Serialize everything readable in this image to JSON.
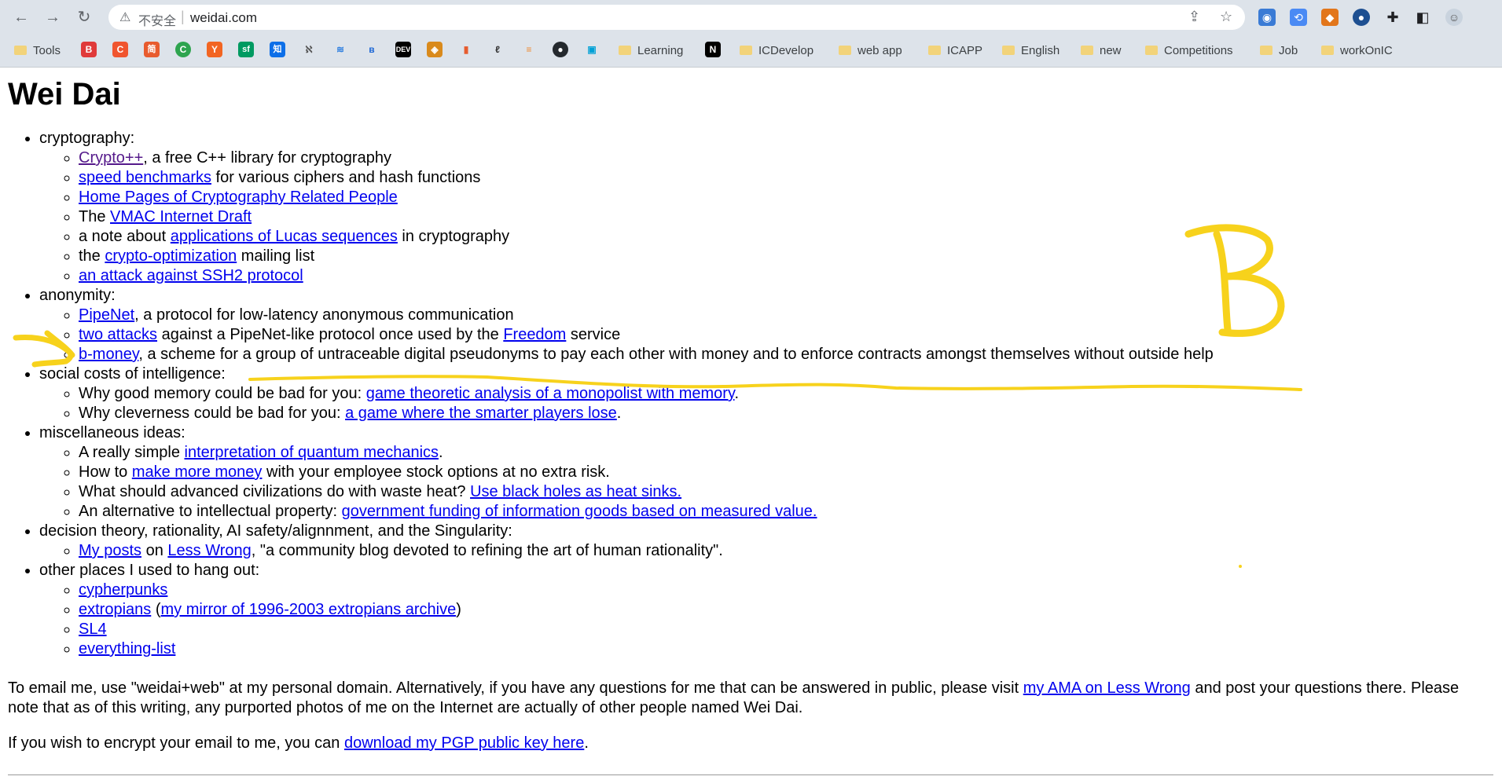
{
  "browser": {
    "insecure_label": "不安全",
    "url": "weidai.com"
  },
  "bookmarks": {
    "tools": "Tools",
    "learning": "Learning",
    "icdevelop": "ICDevelop",
    "webapp": "web app",
    "icapp": "ICAPP",
    "english": "English",
    "new": "new",
    "competitions": "Competitions",
    "job": "Job",
    "workonic": "workOnIC",
    "favicon_simplified": "简",
    "favicon_sf": "sf",
    "favicon_zhi": "知",
    "favicon_dev": "DEV"
  },
  "page": {
    "title": "Wei Dai",
    "sections": [
      {
        "heading": "cryptography:",
        "items": [
          {
            "link1": "Crypto++",
            "text1": ", a free C++ library for cryptography"
          },
          {
            "link1": "speed benchmarks",
            "text1": " for various ciphers and hash functions"
          },
          {
            "link1": "Home Pages of Cryptography Related People"
          },
          {
            "text0": "The ",
            "link1": "VMAC Internet Draft"
          },
          {
            "text0": "a note about ",
            "link1": "applications of Lucas sequences",
            "text1": " in cryptography"
          },
          {
            "text0": "the ",
            "link1": "crypto-optimization",
            "text1": " mailing list"
          },
          {
            "link1": "an attack against SSH2 protocol"
          }
        ]
      },
      {
        "heading": "anonymity:",
        "items": [
          {
            "link1": "PipeNet",
            "text1": ", a protocol for low-latency anonymous communication"
          },
          {
            "link1": "two attacks",
            "text1": " against a PipeNet-like protocol once used by the ",
            "link2": "Freedom",
            "text2": " service"
          },
          {
            "link1": "b-money",
            "text1": ", a scheme for a group of untraceable digital pseudonyms to pay each other with money and to enforce contracts amongst themselves without outside help"
          }
        ]
      },
      {
        "heading": "social costs of intelligence:",
        "items": [
          {
            "text0": "Why good memory could be bad for you: ",
            "link1": "game theoretic analysis of a monopolist with memory",
            "text1": "."
          },
          {
            "text0": "Why cleverness could be bad for you: ",
            "link1": "a game where the smarter players lose",
            "text1": "."
          }
        ]
      },
      {
        "heading": "miscellaneous ideas:",
        "items": [
          {
            "text0": "A really simple ",
            "link1": "interpretation of quantum mechanics",
            "text1": "."
          },
          {
            "text0": "How to ",
            "link1": "make more money",
            "text1": " with your employee stock options at no extra risk."
          },
          {
            "text0": "What should advanced civilizations do with waste heat? ",
            "link1": "Use black holes as heat sinks."
          },
          {
            "text0": "An alternative to intellectual property: ",
            "link1": "government funding of information goods based on measured value."
          }
        ]
      },
      {
        "heading": "decision theory, rationality, AI safety/alignnment, and the Singularity:",
        "items": [
          {
            "link1": "My posts",
            "text1": " on ",
            "link2": "Less Wrong",
            "text2": ", \"a community blog devoted to refining the art of human rationality\"."
          }
        ]
      },
      {
        "heading": "other places I used to hang out:",
        "items": [
          {
            "link1": "cypherpunks"
          },
          {
            "link1": "extropians",
            "text1": " (",
            "link2": "my mirror of 1996-2003 extropians archive",
            "text2": ")"
          },
          {
            "link1": "SL4"
          },
          {
            "link1": "everything-list"
          }
        ]
      }
    ],
    "email_text_before": "To email me, use \"weidai+web\" at my personal domain. Alternatively, if you have any questions for me that can be answered in public, please visit ",
    "email_link": "my AMA on Less Wrong",
    "email_text_after": " and post your questions there. Please note that as of this writing, any purported photos of me on the Internet are actually of other people named Wei Dai.",
    "pgp_text_before": "If you wish to encrypt your email to me, you can ",
    "pgp_link": "download my PGP public key here",
    "pgp_text_after": "."
  },
  "annotation": {
    "letter": "B",
    "color": "#f7d21c"
  }
}
